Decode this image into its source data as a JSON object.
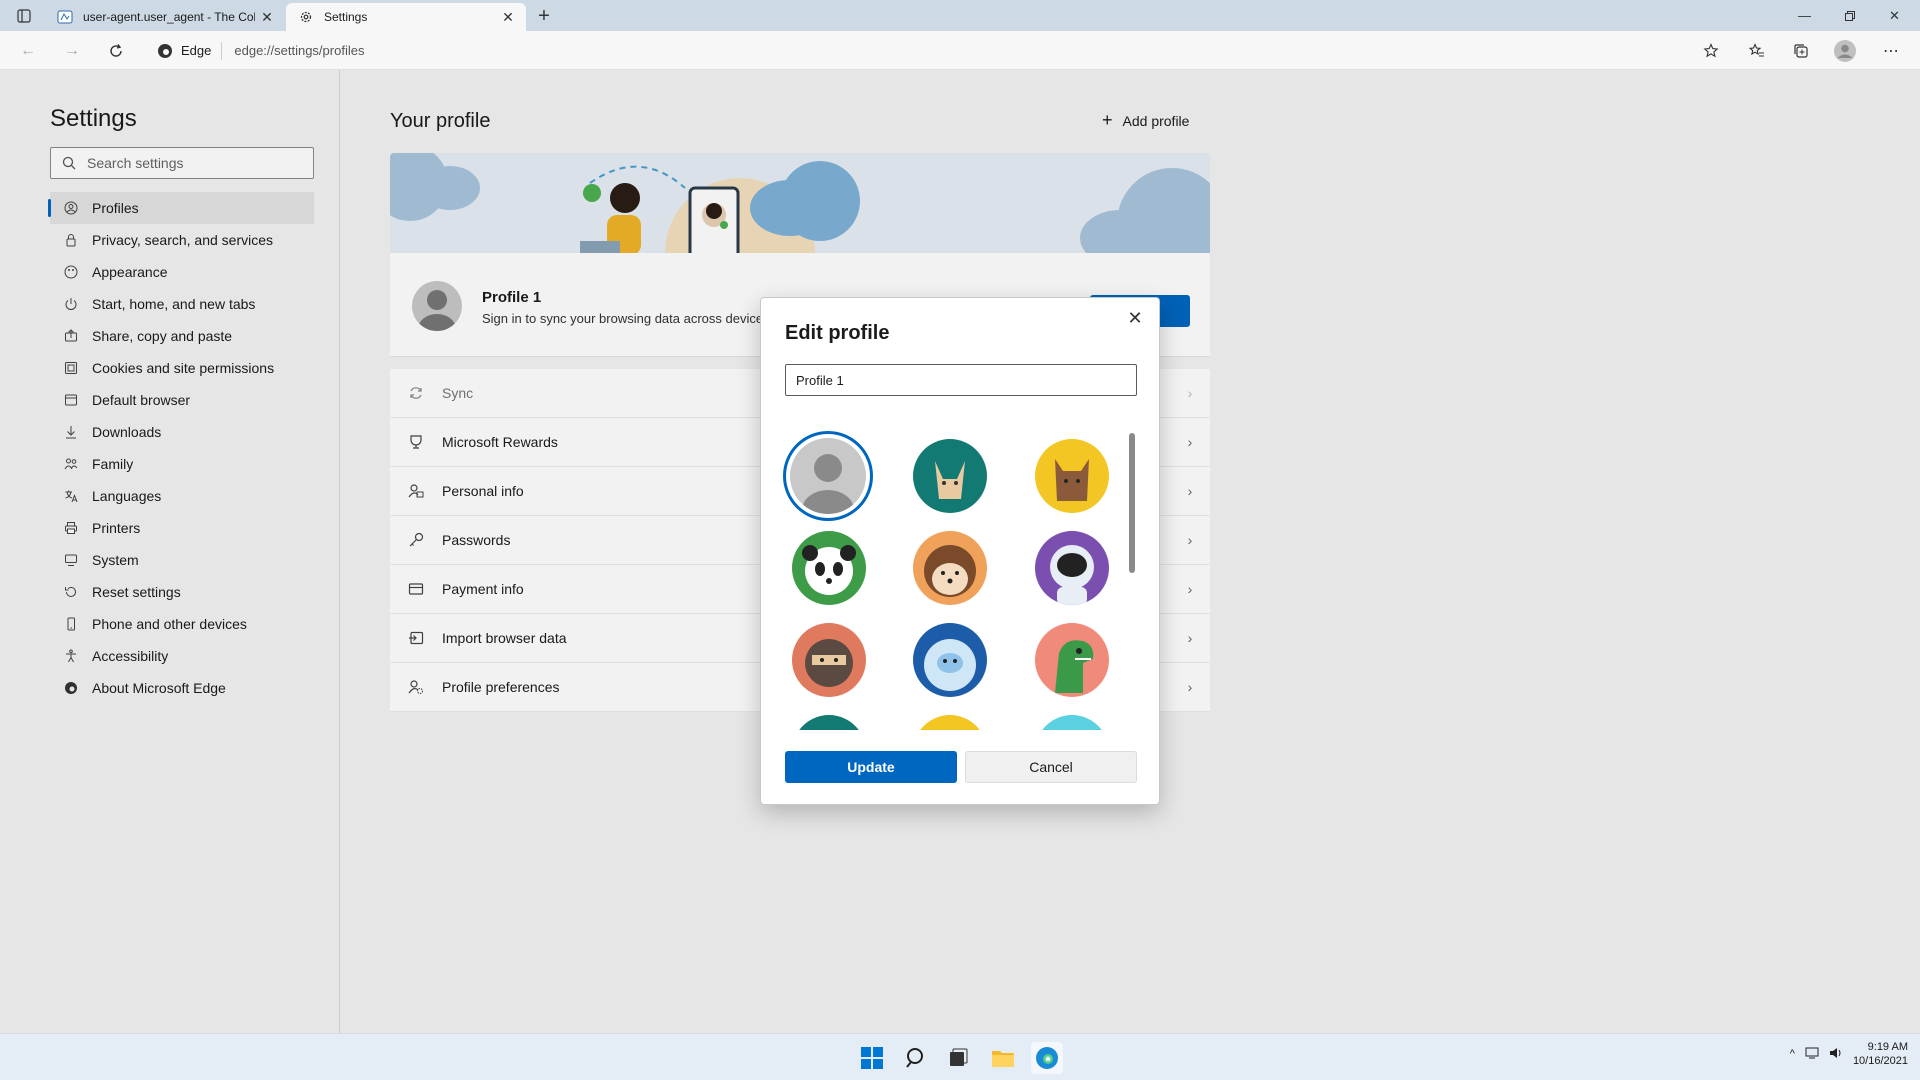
{
  "browser": {
    "tabs": [
      {
        "title": "user-agent.user_agent - The Coll",
        "active": false
      },
      {
        "title": "Settings",
        "active": true
      }
    ],
    "address": {
      "chip_label": "Edge",
      "url": "edge://settings/profiles"
    }
  },
  "sidebar": {
    "title": "Settings",
    "search_placeholder": "Search settings",
    "items": [
      {
        "label": "Profiles",
        "icon": "profile-icon",
        "selected": true
      },
      {
        "label": "Privacy, search, and services",
        "icon": "lock-icon"
      },
      {
        "label": "Appearance",
        "icon": "appearance-icon"
      },
      {
        "label": "Start, home, and new tabs",
        "icon": "power-icon"
      },
      {
        "label": "Share, copy and paste",
        "icon": "share-icon"
      },
      {
        "label": "Cookies and site permissions",
        "icon": "cookie-icon"
      },
      {
        "label": "Default browser",
        "icon": "browser-icon"
      },
      {
        "label": "Downloads",
        "icon": "download-icon"
      },
      {
        "label": "Family",
        "icon": "family-icon"
      },
      {
        "label": "Languages",
        "icon": "language-icon"
      },
      {
        "label": "Printers",
        "icon": "printer-icon"
      },
      {
        "label": "System",
        "icon": "system-icon"
      },
      {
        "label": "Reset settings",
        "icon": "reset-icon"
      },
      {
        "label": "Phone and other devices",
        "icon": "phone-icon"
      },
      {
        "label": "Accessibility",
        "icon": "accessibility-icon"
      },
      {
        "label": "About Microsoft Edge",
        "icon": "edge-icon"
      }
    ]
  },
  "main": {
    "heading": "Your profile",
    "add_profile": "Add profile",
    "profile": {
      "name": "Profile 1",
      "subtitle": "Sign in to sync your browsing data across devices"
    },
    "rows": [
      {
        "label": "Sync",
        "icon": "sync-icon",
        "disabled": true
      },
      {
        "label": "Microsoft Rewards",
        "icon": "rewards-icon"
      },
      {
        "label": "Personal info",
        "icon": "personal-info-icon"
      },
      {
        "label": "Passwords",
        "icon": "key-icon"
      },
      {
        "label": "Payment info",
        "icon": "card-icon"
      },
      {
        "label": "Import browser data",
        "icon": "import-icon"
      },
      {
        "label": "Profile preferences",
        "icon": "preferences-icon"
      }
    ]
  },
  "dialog": {
    "title": "Edit profile",
    "name_value": "Profile 1",
    "avatars": [
      "default-avatar",
      "fox-avatar",
      "cat-avatar",
      "panda-avatar",
      "hedgehog-avatar",
      "astronaut-avatar",
      "ninja-avatar",
      "yeti-avatar",
      "dinosaur-avatar",
      "teal-avatar",
      "yellow-avatar",
      "cyan-avatar"
    ],
    "update_label": "Update",
    "cancel_label": "Cancel"
  },
  "taskbar": {
    "time": "9:19 AM",
    "date": "10/16/2021"
  },
  "colors": {
    "accent": "#0067c0",
    "titlebar": "#cdd9e5",
    "page_bg": "#f3f3f3"
  }
}
